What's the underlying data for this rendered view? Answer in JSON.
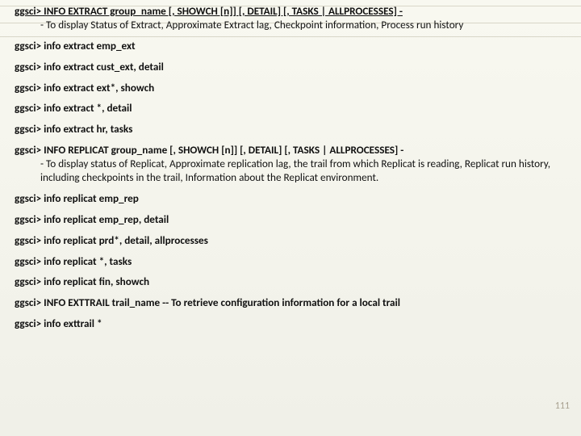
{
  "lines": {
    "l0_cmd": "ggsci> INFO EXTRACT group_name [, SHOWCH [n]] [, DETAIL] [, TASKS | ALLPROCESSES]  -",
    "l0_desc": "- To display Status of Extract, Approximate Extract lag, Checkpoint information, Process run history",
    "l1": "ggsci> info extract emp_ext",
    "l2": "ggsci> info extract cust_ext, detail",
    "l3": "ggsci> info extract ext*, showch",
    "l4": "ggsci> info extract *, detail",
    "l5": "ggsci> info extract hr, tasks",
    "l6_cmd": "ggsci> INFO REPLICAT group_name [, SHOWCH [n]] [, DETAIL] [, TASKS | ALLPROCESSES]  -",
    "l6_desc": "- To display status of Replicat, Approximate replication lag, the trail from which Replicat is reading, Replicat run history, including checkpoints in the trail, Information about the Replicat environment.",
    "l7": "ggsci> info replicat emp_rep",
    "l8": "ggsci> info replicat emp_rep, detail",
    "l9": "ggsci> info replicat prd*, detail, allprocesses",
    "l10": "ggsci> info replicat *, tasks",
    "l11": "ggsci> info replicat fin, showch",
    "l12": "ggsci> INFO EXTTRAIL trail_name   -- To retrieve configuration information for a local trail",
    "l13": "ggsci> info exttrail *"
  },
  "page_number": "111",
  "hairline_tops": [
    7,
    28,
    45
  ]
}
